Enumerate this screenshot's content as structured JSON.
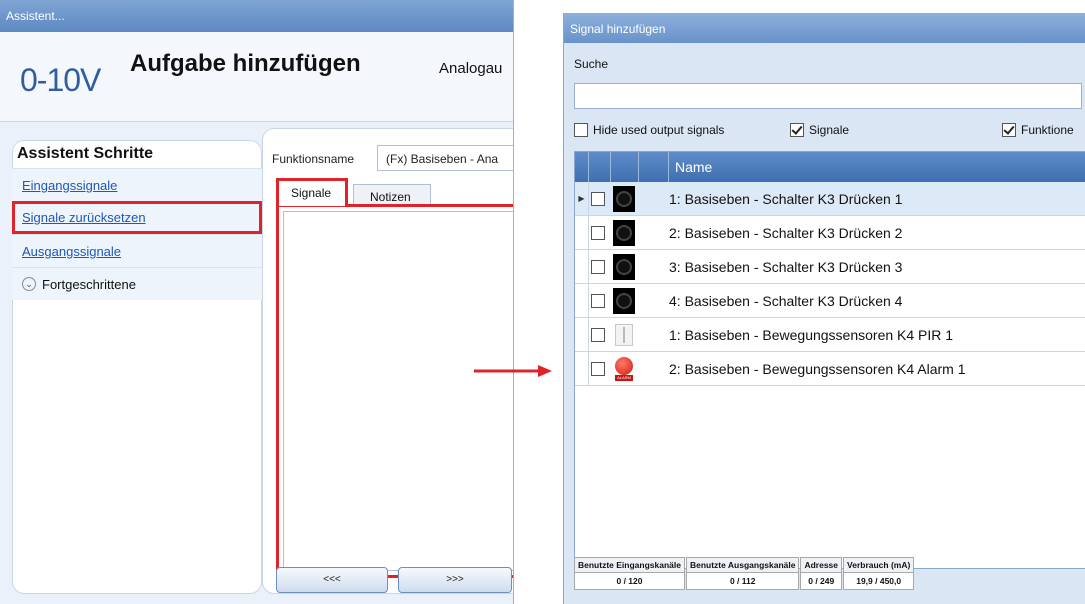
{
  "left": {
    "window_title": "Assistent...",
    "logo": "0-10V",
    "title": "Aufgabe hinzufügen",
    "subtitle": "Analogau",
    "steps_title": "Assistent Schritte",
    "steps": [
      {
        "label": "Eingangssignale"
      },
      {
        "label": "Signale zurücksetzen"
      },
      {
        "label": "Ausgangssignale"
      },
      {
        "label": "Fortgeschrittene"
      }
    ],
    "function_label": "Funktionsname",
    "function_value": "(Fx) Basiseben - Ana",
    "tabs": [
      "Signale",
      "Notizen"
    ],
    "nav_prev": "<<<",
    "nav_next": ">>>"
  },
  "right": {
    "window_title": "Signal hinzufügen",
    "search_label": "Suche",
    "search_value": "",
    "checkboxes": [
      {
        "label": "Hide used output signals",
        "checked": false
      },
      {
        "label": "Signale",
        "checked": true
      },
      {
        "label": "Funktione",
        "checked": true
      }
    ],
    "column_name": "Name",
    "rows": [
      {
        "name": "1: Basiseben - Schalter K3 Drücken 1",
        "icon": "switch-icon",
        "selected": true
      },
      {
        "name": "2: Basiseben - Schalter K3 Drücken 2",
        "icon": "switch-icon",
        "selected": false
      },
      {
        "name": "3: Basiseben - Schalter K3 Drücken 3",
        "icon": "switch-icon",
        "selected": false
      },
      {
        "name": "4: Basiseben - Schalter K3 Drücken 4",
        "icon": "switch-icon",
        "selected": false
      },
      {
        "name": "1: Basiseben - Bewegungssensoren K4 PIR 1",
        "icon": "pir-sensor-icon",
        "selected": false
      },
      {
        "name": "2: Basiseben - Bewegungssensoren K4 Alarm 1",
        "icon": "alarm-icon",
        "selected": false
      }
    ],
    "alarm_icon_text": "ALARM",
    "footer": [
      {
        "header": "Benutzte Eingangskanäle",
        "value": "0 / 120"
      },
      {
        "header": "Benutzte Ausgangskanäle",
        "value": "0 / 112"
      },
      {
        "header": "Adresse",
        "value": "0 / 249"
      },
      {
        "header": "Verbrauch (mA)",
        "value": "19,9 / 450,0"
      }
    ]
  },
  "colors": {
    "accent_red": "#e0232b",
    "header_blue": "#3f6fb0",
    "link_blue": "#1b58b8"
  }
}
